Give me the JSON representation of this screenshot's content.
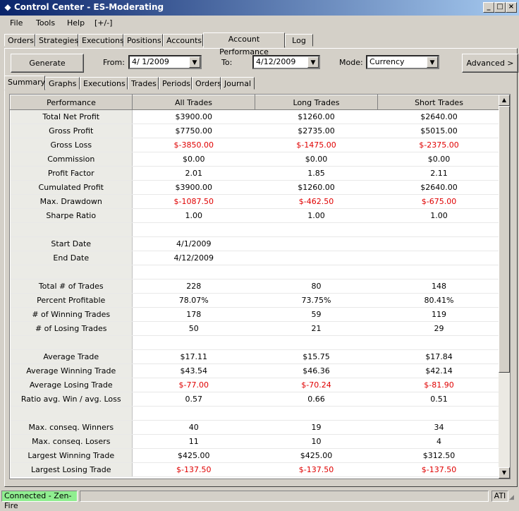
{
  "window": {
    "title": "Control Center - ES-Moderating",
    "minimize": "_",
    "maximize": "□",
    "close": "×"
  },
  "menu": {
    "file": "File",
    "tools": "Tools",
    "help": "Help",
    "toggle": "[+/-]"
  },
  "tabs": [
    "Orders",
    "Strategies",
    "Executions",
    "Positions",
    "Accounts",
    "Account Performance",
    "Log"
  ],
  "active_tab": "Account Performance",
  "controls": {
    "generate_label": "Generate",
    "from_label": "From:",
    "from_value": "4/ 1/2009",
    "to_label": "To:",
    "to_value": "4/12/2009",
    "mode_label": "Mode:",
    "mode_value": "Currency",
    "advanced_label": "Advanced >"
  },
  "subtabs": [
    "Summary",
    "Graphs",
    "Executions",
    "Trades",
    "Periods",
    "Orders",
    "Journal"
  ],
  "active_subtab": "Summary",
  "table": {
    "headers": [
      "Performance",
      "All Trades",
      "Long Trades",
      "Short Trades"
    ],
    "rows": [
      {
        "label": "Total Net Profit",
        "all": "$3900.00",
        "long": "$1260.00",
        "short": "$2640.00",
        "neg": false
      },
      {
        "label": "Gross Profit",
        "all": "$7750.00",
        "long": "$2735.00",
        "short": "$5015.00",
        "neg": false
      },
      {
        "label": "Gross Loss",
        "all": "$-3850.00",
        "long": "$-1475.00",
        "short": "$-2375.00",
        "neg": true
      },
      {
        "label": "Commission",
        "all": "$0.00",
        "long": "$0.00",
        "short": "$0.00",
        "neg": false
      },
      {
        "label": "Profit Factor",
        "all": "2.01",
        "long": "1.85",
        "short": "2.11",
        "neg": false
      },
      {
        "label": "Cumulated Profit",
        "all": "$3900.00",
        "long": "$1260.00",
        "short": "$2640.00",
        "neg": false
      },
      {
        "label": "Max. Drawdown",
        "all": "$-1087.50",
        "long": "$-462.50",
        "short": "$-675.00",
        "neg": true
      },
      {
        "label": "Sharpe Ratio",
        "all": "1.00",
        "long": "1.00",
        "short": "1.00",
        "neg": false
      },
      {
        "label": "",
        "all": "",
        "long": "",
        "short": "",
        "neg": false
      },
      {
        "label": "Start Date",
        "all": "4/1/2009",
        "long": "",
        "short": "",
        "neg": false
      },
      {
        "label": "End Date",
        "all": "4/12/2009",
        "long": "",
        "short": "",
        "neg": false
      },
      {
        "label": "",
        "all": "",
        "long": "",
        "short": "",
        "neg": false
      },
      {
        "label": "Total # of Trades",
        "all": "228",
        "long": "80",
        "short": "148",
        "neg": false
      },
      {
        "label": "Percent Profitable",
        "all": "78.07%",
        "long": "73.75%",
        "short": "80.41%",
        "neg": false
      },
      {
        "label": "# of Winning Trades",
        "all": "178",
        "long": "59",
        "short": "119",
        "neg": false
      },
      {
        "label": "# of Losing Trades",
        "all": "50",
        "long": "21",
        "short": "29",
        "neg": false
      },
      {
        "label": "",
        "all": "",
        "long": "",
        "short": "",
        "neg": false
      },
      {
        "label": "Average Trade",
        "all": "$17.11",
        "long": "$15.75",
        "short": "$17.84",
        "neg": false
      },
      {
        "label": "Average Winning Trade",
        "all": "$43.54",
        "long": "$46.36",
        "short": "$42.14",
        "neg": false
      },
      {
        "label": "Average Losing Trade",
        "all": "$-77.00",
        "long": "$-70.24",
        "short": "$-81.90",
        "neg": true
      },
      {
        "label": "Ratio avg. Win / avg. Loss",
        "all": "0.57",
        "long": "0.66",
        "short": "0.51",
        "neg": false
      },
      {
        "label": "",
        "all": "",
        "long": "",
        "short": "",
        "neg": false
      },
      {
        "label": "Max. conseq. Winners",
        "all": "40",
        "long": "19",
        "short": "34",
        "neg": false
      },
      {
        "label": "Max. conseq. Losers",
        "all": "11",
        "long": "10",
        "short": "4",
        "neg": false
      },
      {
        "label": "Largest Winning Trade",
        "all": "$425.00",
        "long": "$425.00",
        "short": "$312.50",
        "neg": false
      },
      {
        "label": "Largest Losing Trade",
        "all": "$-137.50",
        "long": "$-137.50",
        "short": "$-137.50",
        "neg": true
      }
    ]
  },
  "status": {
    "connection": "Connected - Zen-Fire",
    "ati": "ATI",
    "connection_color": "#90ee90"
  }
}
